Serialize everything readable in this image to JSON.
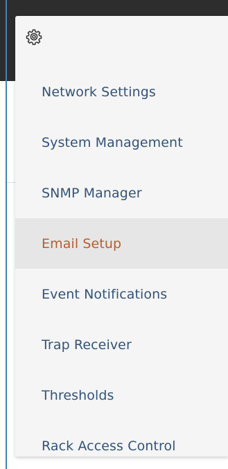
{
  "menu": {
    "header_icon": "gear-icon",
    "items": [
      {
        "label": "Network Settings",
        "name": "menu-item-network-settings",
        "active": false
      },
      {
        "label": "System Management",
        "name": "menu-item-system-management",
        "active": false
      },
      {
        "label": "SNMP Manager",
        "name": "menu-item-snmp-manager",
        "active": false
      },
      {
        "label": "Email Setup",
        "name": "menu-item-email-setup",
        "active": true
      },
      {
        "label": "Event Notifications",
        "name": "menu-item-event-notifications",
        "active": false
      },
      {
        "label": "Trap Receiver",
        "name": "menu-item-trap-receiver",
        "active": false
      },
      {
        "label": "Thresholds",
        "name": "menu-item-thresholds",
        "active": false
      },
      {
        "label": "Rack Access Control",
        "name": "menu-item-rack-access-control",
        "active": false
      }
    ]
  },
  "colors": {
    "link": "#33537a",
    "active_link": "#b55d2e",
    "active_bg": "#e6e6e6",
    "menu_bg": "#f5f5f5",
    "top_bar": "#2d2d2d",
    "accent_edge": "#3d86b8"
  }
}
